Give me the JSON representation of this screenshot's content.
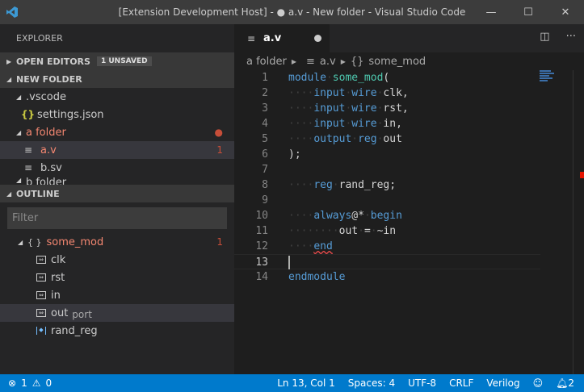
{
  "window": {
    "title": "[Extension Development Host] - ● a.v - New folder - Visual Studio Code",
    "minimize": "—",
    "maximize": "☐",
    "close": "✕"
  },
  "sidebar": {
    "title": "EXPLORER",
    "open_editors": {
      "label": "OPEN EDITORS",
      "badge": "1 UNSAVED"
    },
    "folder": {
      "label": "NEW FOLDER"
    },
    "tree": [
      {
        "label": ".vscode",
        "type": "folder"
      },
      {
        "label": "settings.json",
        "type": "json"
      },
      {
        "label": "a folder",
        "type": "folder",
        "modified": true
      },
      {
        "label": "a.v",
        "type": "file",
        "problems": "1"
      },
      {
        "label": "b.sv",
        "type": "file"
      },
      {
        "label": "b folder",
        "type": "folder"
      }
    ],
    "outline": {
      "label": "OUTLINE",
      "filter_placeholder": "Filter",
      "root": {
        "label": "some_mod",
        "problems": "1"
      },
      "items": [
        {
          "label": "clk",
          "icon": "port-icon"
        },
        {
          "label": "rst",
          "icon": "port-icon"
        },
        {
          "label": "in",
          "icon": "port-icon"
        },
        {
          "label": "out",
          "detail": "port",
          "icon": "port-icon"
        },
        {
          "label": "rand_reg",
          "icon": "variable-icon"
        }
      ]
    }
  },
  "editor": {
    "tab": {
      "label": "a.v",
      "dirty": true
    },
    "breadcrumbs": [
      "a folder",
      "a.v",
      "some_mod"
    ],
    "current_line": 13,
    "lines": [
      [
        [
          "kw",
          "module"
        ],
        [
          "ws",
          "·"
        ],
        [
          "ty",
          "some_mod"
        ],
        [
          "pl",
          "("
        ]
      ],
      [
        [
          "ws",
          "····"
        ],
        [
          "kw",
          "input"
        ],
        [
          "ws",
          "·"
        ],
        [
          "kw",
          "wire"
        ],
        [
          "ws",
          "·"
        ],
        [
          "pl",
          "clk,"
        ]
      ],
      [
        [
          "ws",
          "····"
        ],
        [
          "kw",
          "input"
        ],
        [
          "ws",
          "·"
        ],
        [
          "kw",
          "wire"
        ],
        [
          "ws",
          "·"
        ],
        [
          "pl",
          "rst,"
        ]
      ],
      [
        [
          "ws",
          "····"
        ],
        [
          "kw",
          "input"
        ],
        [
          "ws",
          "·"
        ],
        [
          "kw",
          "wire"
        ],
        [
          "ws",
          "·"
        ],
        [
          "pl",
          "in,"
        ]
      ],
      [
        [
          "ws",
          "····"
        ],
        [
          "kw",
          "output"
        ],
        [
          "ws",
          "·"
        ],
        [
          "kw",
          "reg"
        ],
        [
          "ws",
          "·"
        ],
        [
          "pl",
          "out"
        ]
      ],
      [
        [
          "pl",
          ");"
        ]
      ],
      [],
      [
        [
          "ws",
          "····"
        ],
        [
          "kw",
          "reg"
        ],
        [
          "ws",
          "·"
        ],
        [
          "pl",
          "rand_reg;"
        ]
      ],
      [],
      [
        [
          "ws",
          "····"
        ],
        [
          "kw",
          "always"
        ],
        [
          "pl",
          "@*"
        ],
        [
          "ws",
          "·"
        ],
        [
          "kw",
          "begin"
        ]
      ],
      [
        [
          "ws",
          "········"
        ],
        [
          "pl",
          "out"
        ],
        [
          "ws",
          "·"
        ],
        [
          "pl",
          "="
        ],
        [
          "ws",
          "·"
        ],
        [
          "pl",
          "~in"
        ]
      ],
      [
        [
          "ws",
          "····"
        ],
        [
          "kw squig",
          "end"
        ]
      ],
      [],
      [
        [
          "kw",
          "endmodule"
        ]
      ]
    ]
  },
  "status": {
    "errors": "1",
    "warnings": "0",
    "position": "Ln 13, Col 1",
    "spaces": "Spaces: 4",
    "encoding": "UTF-8",
    "eol": "CRLF",
    "language": "Verilog",
    "notifications": "2"
  },
  "colors": {
    "accent": "#007acc",
    "keyword": "#569cd6",
    "type": "#4ec9b0",
    "error": "#f48771"
  }
}
